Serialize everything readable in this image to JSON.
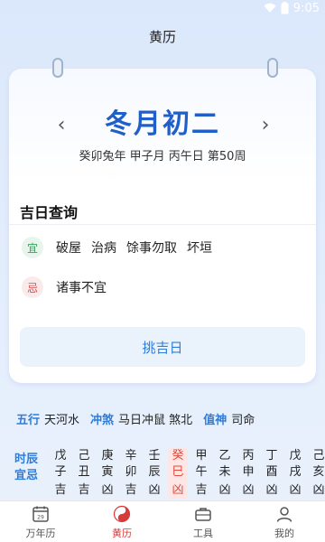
{
  "status_bar": {
    "left_text": "",
    "time": "9:05"
  },
  "header": {
    "title": "黄历"
  },
  "calendar": {
    "lunar_date": "冬月初二",
    "ganzhi": "癸卯兔年 甲子月 丙午日 第50周",
    "prev_icon": "chevron-left-icon",
    "next_icon": "chevron-right-icon"
  },
  "auspicious": {
    "title": "吉日查询",
    "yi_badge": "宜",
    "yi_items": [
      "破屋",
      "治病",
      "馀事勿取",
      "坏垣"
    ],
    "ji_badge": "忌",
    "ji_text": "诸事不宜",
    "pick_button": "挑吉日"
  },
  "info": {
    "wuxing_label": "五行",
    "wuxing_value": "天河水",
    "chongsha_label": "冲煞",
    "chongsha_value": "马日冲鼠 煞北",
    "zhishen_label": "值神",
    "zhishen_value": "司命"
  },
  "hours": {
    "label_line1": "时辰",
    "label_line2": "宜忌",
    "columns": [
      {
        "stem": "戊",
        "branch": "子",
        "luck": "吉",
        "current": false
      },
      {
        "stem": "己",
        "branch": "丑",
        "luck": "吉",
        "current": false
      },
      {
        "stem": "庚",
        "branch": "寅",
        "luck": "凶",
        "current": false
      },
      {
        "stem": "辛",
        "branch": "卯",
        "luck": "吉",
        "current": false
      },
      {
        "stem": "壬",
        "branch": "辰",
        "luck": "凶",
        "current": false
      },
      {
        "stem": "癸",
        "branch": "巳",
        "luck": "凶",
        "current": true
      },
      {
        "stem": "甲",
        "branch": "午",
        "luck": "吉",
        "current": false
      },
      {
        "stem": "乙",
        "branch": "未",
        "luck": "凶",
        "current": false
      },
      {
        "stem": "丙",
        "branch": "申",
        "luck": "凶",
        "current": false
      },
      {
        "stem": "丁",
        "branch": "酉",
        "luck": "凶",
        "current": false
      },
      {
        "stem": "戊",
        "branch": "戌",
        "luck": "凶",
        "current": false
      },
      {
        "stem": "己",
        "branch": "亥",
        "luck": "凶",
        "current": false
      }
    ]
  },
  "bottom_nav": {
    "items": [
      {
        "label": "万年历",
        "icon": "calendar-icon",
        "active": false
      },
      {
        "label": "黄历",
        "icon": "yinyang-icon",
        "active": true
      },
      {
        "label": "工具",
        "icon": "briefcase-icon",
        "active": false
      },
      {
        "label": "我的",
        "icon": "user-icon",
        "active": false
      }
    ]
  },
  "colors": {
    "accent_blue": "#2f7dd8",
    "lunar_blue": "#1f5fc9",
    "active_red": "#d83a3a",
    "yi_green": "#37a35e",
    "ji_red": "#d2504f"
  }
}
